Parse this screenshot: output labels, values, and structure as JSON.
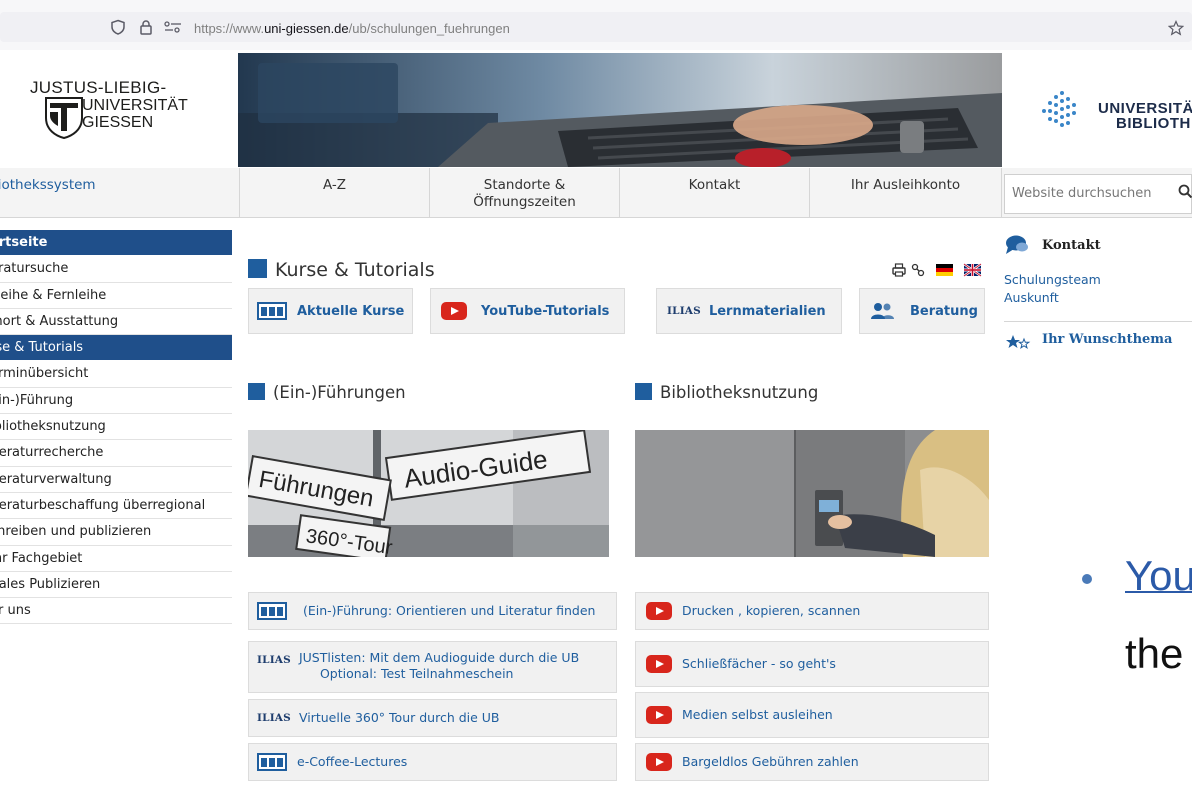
{
  "browser": {
    "url_prefix": "https://www.",
    "url_domain": "uni-giessen.de",
    "url_path": "/ub/schulungen_fuehrungen"
  },
  "header": {
    "jlu_line1": "JUSTUS-LIEBIG-",
    "jlu_line2": "UNIVERSITÄT",
    "jlu_line3": "GIESSEN",
    "ub_line1": "UNIVERSITÄ",
    "ub_line2": "BIBLIOTH"
  },
  "topnav": {
    "items": [
      {
        "label": "liothekssystem"
      },
      {
        "label": "A-Z"
      },
      {
        "label": "Standorte &\nÖffnungszeiten"
      },
      {
        "label": "Kontakt"
      },
      {
        "label": "Ihr Ausleihkonto"
      }
    ],
    "search_placeholder": "Website durchsuchen"
  },
  "sidebar": {
    "items": [
      {
        "label": "artseite"
      },
      {
        "label": "eratursuche"
      },
      {
        "label": "sleihe & Fernleihe"
      },
      {
        "label": "mort & Ausstattung"
      },
      {
        "label": "rse & Tutorials"
      },
      {
        "label": "erminübersicht"
      },
      {
        "label": "Ein-)Führung"
      },
      {
        "label": "ibliotheksnutzung"
      },
      {
        "label": "iteraturrecherche"
      },
      {
        "label": "iteraturverwaltung"
      },
      {
        "label": "iteraturbeschaffung überregional"
      },
      {
        "label": "chreiben und publizieren"
      },
      {
        "label": " Ihr Fachgebiet"
      },
      {
        "label": "itales Publizieren"
      },
      {
        "label": "er uns"
      }
    ]
  },
  "main": {
    "title": "Kurse & Tutorials",
    "tiles": [
      {
        "label": "Aktuelle Kurse",
        "icon": "course-icon"
      },
      {
        "label": "YouTube-Tutorials",
        "icon": "youtube-icon"
      },
      {
        "label": "Lernmaterialien",
        "icon": "ilias-icon",
        "prefix": "ILIAS"
      },
      {
        "label": "Beratung",
        "icon": "people-icon"
      }
    ],
    "section_left": "(Ein-)Führungen",
    "section_right": "Bibliotheksnutzung",
    "image_left_signs": {
      "sign1": "Führungen",
      "sign2": "Audio-Guide",
      "sign3": "360°-Tour"
    },
    "left_list": [
      {
        "label": "(Ein-)Führung: Orientieren und Literatur finden",
        "icon": "course-icon"
      },
      {
        "label": "JUSTlisten: Mit dem Audioguide durch die UB",
        "label2": "Optional: Test Teilnahmeschein",
        "icon": "ilias-icon",
        "prefix": "ILIAS"
      },
      {
        "label": "Virtuelle 360° Tour durch die UB",
        "icon": "ilias-icon",
        "prefix": "ILIAS"
      },
      {
        "label": "e-Coffee-Lectures",
        "icon": "course-icon"
      }
    ],
    "right_list": [
      {
        "label": "Drucken , kopieren, scannen",
        "icon": "youtube-icon"
      },
      {
        "label": "Schließfächer - so geht's",
        "icon": "youtube-icon"
      },
      {
        "label": "Medien selbst ausleihen",
        "icon": "youtube-icon"
      },
      {
        "label": "Bargeldlos Gebühren zahlen",
        "icon": "youtube-icon"
      }
    ]
  },
  "right_column": {
    "kontakt_heading": "Kontakt",
    "link1": "Schulungsteam",
    "link2": "Auskunft",
    "wunschthema": "Ihr Wunschthema"
  },
  "overlay": {
    "link_text": "You",
    "text": "the"
  },
  "colors": {
    "accent": "#1f5e9e",
    "sidebar_active": "#1f4f8a",
    "youtube_red": "#d8261c"
  }
}
